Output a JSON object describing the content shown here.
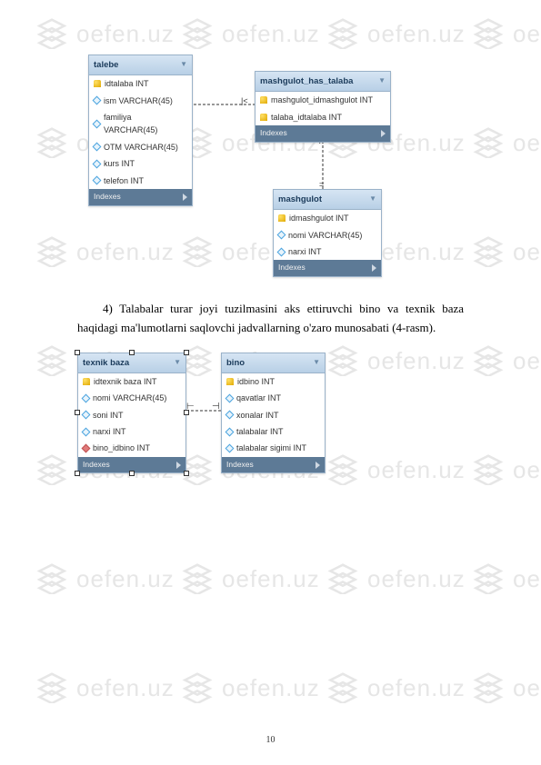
{
  "watermark_text": "oefen.uz",
  "paragraph1": "4) Talabalar turar joyi tuzilmasini aks ettiruvchi bino va texnik baza haqidagi ma'lumotlarni saqlovchi jadvallarning o'zaro munosabati (4-rasm).",
  "page_number": "10",
  "tables": {
    "talebe": {
      "title": "talebe",
      "rows": [
        {
          "k": "pk",
          "t": "idtalaba INT"
        },
        {
          "k": "d",
          "t": "ism VARCHAR(45)"
        },
        {
          "k": "d",
          "t": "familiya VARCHAR(45)"
        },
        {
          "k": "d",
          "t": "OTM VARCHAR(45)"
        },
        {
          "k": "d",
          "t": "kurs INT"
        },
        {
          "k": "d",
          "t": "telefon INT"
        }
      ],
      "footer": "Indexes"
    },
    "mashgulot_has_talaba": {
      "title": "mashgulot_has_talaba",
      "rows": [
        {
          "k": "pk",
          "t": "mashgulot_idmashgulot INT"
        },
        {
          "k": "pk",
          "t": "talaba_idtalaba INT"
        }
      ],
      "footer": "Indexes"
    },
    "mashgulot": {
      "title": "mashgulot",
      "rows": [
        {
          "k": "pk",
          "t": "idmashgulot INT"
        },
        {
          "k": "d",
          "t": "nomi VARCHAR(45)"
        },
        {
          "k": "d",
          "t": "narxi INT"
        }
      ],
      "footer": "Indexes"
    },
    "texnik_baza": {
      "title": "texnik baza",
      "rows": [
        {
          "k": "pk",
          "t": "idtexnik baza INT"
        },
        {
          "k": "d",
          "t": "nomi VARCHAR(45)"
        },
        {
          "k": "d",
          "t": "soni INT"
        },
        {
          "k": "d",
          "t": "narxi INT"
        },
        {
          "k": "fk",
          "t": "bino_idbino INT"
        }
      ],
      "footer": "Indexes"
    },
    "bino": {
      "title": "bino",
      "rows": [
        {
          "k": "pk",
          "t": "idbino INT"
        },
        {
          "k": "d",
          "t": "qavatlar INT"
        },
        {
          "k": "d",
          "t": "xonalar INT"
        },
        {
          "k": "d",
          "t": "talabalar INT"
        },
        {
          "k": "d",
          "t": "talabalar sigimi INT"
        }
      ],
      "footer": "Indexes"
    }
  }
}
